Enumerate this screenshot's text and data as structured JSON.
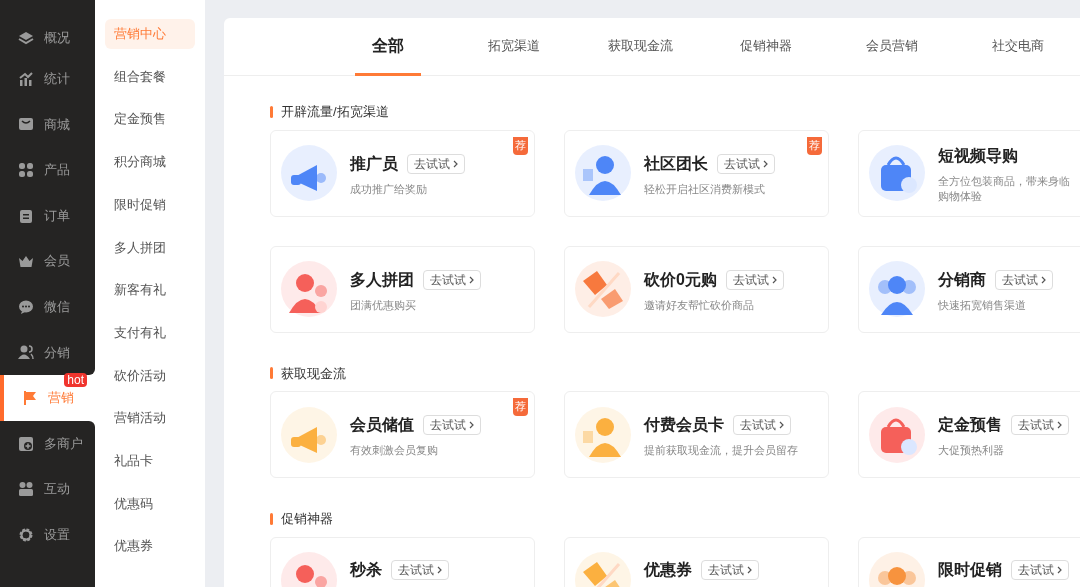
{
  "nav": {
    "items": [
      {
        "label": "概况",
        "selected": false
      },
      {
        "label": "统计",
        "selected": false
      },
      {
        "label": "商城",
        "selected": false
      },
      {
        "label": "产品",
        "selected": false
      },
      {
        "label": "订单",
        "selected": false
      },
      {
        "label": "会员",
        "selected": false
      },
      {
        "label": "微信",
        "selected": false
      },
      {
        "label": "分销",
        "selected": false
      },
      {
        "label": "营销",
        "selected": true,
        "badge": "hot"
      },
      {
        "label": "多商户",
        "selected": false
      },
      {
        "label": "互动",
        "selected": false
      },
      {
        "label": "设置",
        "selected": false
      }
    ]
  },
  "subnav": {
    "items": [
      {
        "label": "营销中心",
        "selected": true
      },
      {
        "label": "组合套餐",
        "selected": false
      },
      {
        "label": "定金预售",
        "selected": false
      },
      {
        "label": "积分商城",
        "selected": false
      },
      {
        "label": "限时促销",
        "selected": false
      },
      {
        "label": "多人拼团",
        "selected": false
      },
      {
        "label": "新客有礼",
        "selected": false
      },
      {
        "label": "支付有礼",
        "selected": false
      },
      {
        "label": "砍价活动",
        "selected": false
      },
      {
        "label": "营销活动",
        "selected": false
      },
      {
        "label": "礼品卡",
        "selected": false
      },
      {
        "label": "优惠码",
        "selected": false
      },
      {
        "label": "优惠券",
        "selected": false
      }
    ]
  },
  "tabs": [
    {
      "label": "全部",
      "selected": true
    },
    {
      "label": "拓宽渠道",
      "selected": false
    },
    {
      "label": "获取现金流",
      "selected": false
    },
    {
      "label": "促销神器",
      "selected": false
    },
    {
      "label": "会员营销",
      "selected": false
    },
    {
      "label": "社交电商",
      "selected": false
    }
  ],
  "sections": [
    {
      "title": "开辟流量/拓宽渠道",
      "cards": [
        {
          "title": "推广员",
          "button": "去试试",
          "desc": [
            "成功推广给奖励"
          ],
          "badge": "荐",
          "color": "#4e86f7"
        },
        {
          "title": "社区团长",
          "button": "去试试",
          "desc": [
            "轻松开启社区消费新模式"
          ],
          "badge": "荐",
          "color": "#4e86f7"
        },
        {
          "title": "短视频导购",
          "desc": [
            "全方位包装商品，带来身临",
            "购物体验"
          ],
          "color": "#4e86f7"
        },
        {
          "title": "多人拼团",
          "button": "去试试",
          "desc": [
            "团满优惠购买"
          ],
          "color": "#f5605a"
        },
        {
          "title": "砍价0元购",
          "button": "去试试",
          "desc": [
            "邀请好友帮忙砍价商品"
          ],
          "color": "#f7793e"
        },
        {
          "title": "分销商",
          "button": "去试试",
          "desc": [
            "快速拓宽销售渠道"
          ],
          "color": "#4e86f7"
        }
      ]
    },
    {
      "title": "获取现金流",
      "cards": [
        {
          "title": "会员储值",
          "button": "去试试",
          "desc": [
            "有效刺激会员复购"
          ],
          "badge": "荐",
          "color": "#fbb040"
        },
        {
          "title": "付费会员卡",
          "button": "去试试",
          "desc": [
            "提前获取现金流，提升会员留存"
          ],
          "color": "#fbb040"
        },
        {
          "title": "定金预售",
          "button": "去试试",
          "desc": [
            "大促预热利器"
          ],
          "color": "#f5605a"
        }
      ]
    },
    {
      "title": "促销神器",
      "cards": [
        {
          "title": "秒杀",
          "button": "去试试",
          "color": "#f5605a"
        },
        {
          "title": "优惠券",
          "button": "去试试",
          "color": "#fbb040"
        },
        {
          "title": "限时促销",
          "button": "去试试",
          "color": "#f7933e"
        }
      ]
    }
  ]
}
